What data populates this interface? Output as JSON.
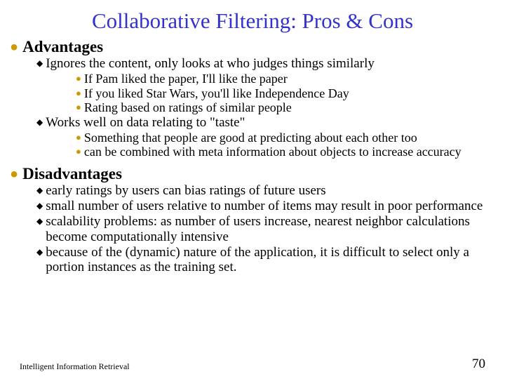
{
  "title": "Collaborative Filtering: Pros & Cons",
  "sections": [
    {
      "heading": "Advantages",
      "items": [
        {
          "text": "Ignores the content, only looks at who judges things similarly",
          "sub": [
            "If Pam liked the paper, I'll like the paper",
            "If you liked Star Wars, you'll like Independence Day",
            "Rating based on ratings of similar people"
          ]
        },
        {
          "text": "Works well on data relating to \"taste\"",
          "sub": [
            "Something that people are good at predicting about each other too",
            "can be combined with meta information about objects to increase accuracy"
          ]
        }
      ]
    },
    {
      "heading": "Disadvantages",
      "items": [
        {
          "text": "early ratings by users can bias ratings of future users",
          "sub": []
        },
        {
          "text": "small number of users relative to number of items may result in poor performance",
          "sub": []
        },
        {
          "text": "scalability problems: as number of users increase, nearest neighbor calculations become computationally intensive",
          "sub": []
        },
        {
          "text": "because of the (dynamic) nature of the application, it is difficult to select only a portion instances as the training set.",
          "sub": []
        }
      ]
    }
  ],
  "footer": {
    "left": "Intelligent Information Retrieval",
    "right": "70"
  }
}
